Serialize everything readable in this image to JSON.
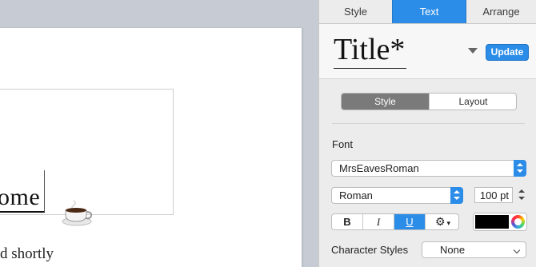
{
  "document": {
    "body_text": "ome",
    "caption_text": "d shortly"
  },
  "inspector": {
    "tabs": [
      {
        "label": "Style",
        "active": false
      },
      {
        "label": "Text",
        "active": true
      },
      {
        "label": "Arrange",
        "active": false
      }
    ],
    "paragraph_style": {
      "name": "Title*",
      "update_label": "Update"
    },
    "segmented": {
      "items": [
        "Style",
        "Layout"
      ],
      "selected": "Style"
    },
    "font": {
      "section_label": "Font",
      "family": "MrsEavesRoman",
      "typeface": "Roman",
      "size": "100 pt"
    },
    "format_buttons": {
      "bold": "B",
      "italic": "I",
      "underline": "U",
      "underline_active": true,
      "gear_icon": "gear-icon"
    },
    "text_color": "#000000",
    "character_styles": {
      "label": "Character Styles",
      "value": "None"
    },
    "accent_color": "#2c8de8"
  }
}
